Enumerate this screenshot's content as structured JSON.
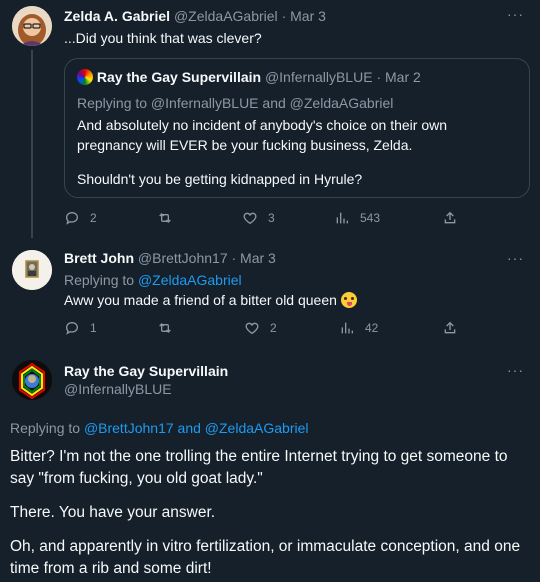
{
  "tweet1": {
    "name": "Zelda A. Gabriel",
    "handle": "@ZeldaAGabriel",
    "date": "· Mar 3",
    "text": "...Did you think that was clever?",
    "quote": {
      "name": "Ray the Gay Supervillain",
      "handle": "@InfernallyBLUE",
      "date": "· Mar 2",
      "replying": "Replying to @InfernallyBLUE and @ZeldaAGabriel",
      "p1": "And absolutely no incident of anybody's choice on their own pregnancy will EVER be your fucking business, Zelda.",
      "p2": "Shouldn't you be getting kidnapped in Hyrule?"
    },
    "stats": {
      "replies": "2",
      "retweets": "",
      "likes": "3",
      "views": "543"
    }
  },
  "tweet2": {
    "name": "Brett John",
    "handle": "@BrettJohn17",
    "date": "· Mar 3",
    "replying_prefix": "Replying to",
    "replying_handle": "@ZeldaAGabriel",
    "text": "Aww you made a friend of a bitter old queen",
    "emoji": "tongue-wink-emoji",
    "stats": {
      "replies": "1",
      "retweets": "",
      "likes": "2",
      "views": "42"
    }
  },
  "tweet3": {
    "name": "Ray the Gay Supervillain",
    "handle": "@InfernallyBLUE",
    "replying_prefix": "Replying to",
    "replying_handles": "@BrettJohn17 and @ZeldaAGabriel",
    "p1": "Bitter? I'm not the one trolling the entire Internet trying to get someone to say \"from fucking, you old goat lady.\"",
    "p2": "There. You have your answer.",
    "p3": "Oh, and apparently in vitro fertilization, or immaculate conception, and one time from a rib and some dirt!"
  },
  "more_label": "···",
  "colors": {
    "background": "#15202b",
    "muted": "#8b98a5",
    "link": "#1d9bf0",
    "border": "#38444d"
  }
}
